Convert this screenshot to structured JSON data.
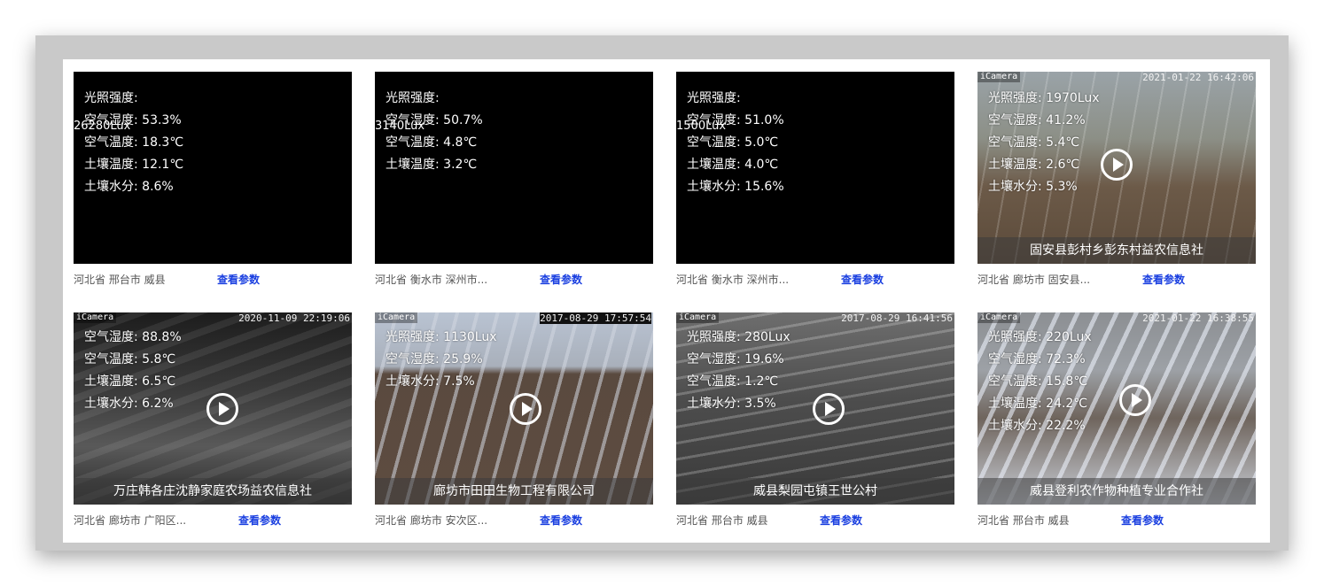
{
  "cards": [
    {
      "readings": [
        "光照强度:",
        "空气湿度: 53.3%",
        "空气温度: 18.3℃",
        "土壤温度: 12.1℃",
        "土壤水分: 8.6%"
      ],
      "lux_overlap": "26280Lux",
      "camera_tag": "",
      "timestamp": "",
      "caption": "",
      "location": "河北省 邢台市 威县",
      "params_label": "查看参数"
    },
    {
      "readings": [
        "光照强度:",
        "空气湿度: 50.7%",
        "空气温度: 4.8℃",
        "土壤温度: 3.2℃"
      ],
      "lux_overlap": "3140Lux",
      "camera_tag": "",
      "timestamp": "",
      "caption": "",
      "location": "河北省 衡水市 深州市...",
      "params_label": "查看参数"
    },
    {
      "readings": [
        "光照强度:",
        "空气湿度: 51.0%",
        "空气温度: 5.0℃",
        "土壤温度: 4.0℃",
        "土壤水分: 15.6%"
      ],
      "lux_overlap": "1500Lux",
      "camera_tag": "",
      "timestamp": "",
      "caption": "",
      "location": "河北省 衡水市 深州市...",
      "params_label": "查看参数"
    },
    {
      "readings": [
        "光照强度: 1970Lux",
        "空气湿度: 41.2%",
        "空气温度: 5.4℃",
        "土壤温度: 2.6℃",
        "土壤水分: 5.3%"
      ],
      "lux_overlap": "",
      "camera_tag": "iCamera",
      "timestamp": "2021-01-22 16:42:06",
      "caption": "固安县彭村乡彭东村益农信息社",
      "location": "河北省 廊坊市 固安县...",
      "params_label": "查看参数"
    },
    {
      "readings": [
        "空气湿度: 88.8%",
        "空气温度: 5.8℃",
        "土壤温度: 6.5℃",
        "土壤水分: 6.2%"
      ],
      "lux_overlap": "",
      "camera_tag": "iCamera",
      "timestamp": "2020-11-09 22:19:06",
      "caption": "万庄韩各庄沈静家庭农场益农信息社",
      "location": "河北省 廊坊市 广阳区...",
      "params_label": "查看参数"
    },
    {
      "readings": [
        "光照强度: 1130Lux",
        "空气湿度: 25.9%",
        "土壤水分: 7.5%"
      ],
      "lux_overlap": "",
      "camera_tag": "iCamera",
      "timestamp": "2017-08-29 17:57:54",
      "caption": "廊坊市田田生物工程有限公司",
      "location": "河北省 廊坊市 安次区...",
      "params_label": "查看参数"
    },
    {
      "readings": [
        "光照强度: 280Lux",
        "空气湿度: 19.6%",
        "空气温度: 1.2℃",
        "土壤水分: 3.5%"
      ],
      "lux_overlap": "",
      "camera_tag": "iCamera",
      "timestamp": "2017-08-29 16:41:56",
      "caption": "威县梨园屯镇王世公村",
      "location": "河北省 邢台市 威县",
      "params_label": "查看参数"
    },
    {
      "readings": [
        "光照强度: 220Lux",
        "空气湿度: 72.3%",
        "空气温度: 15.8℃",
        "土壤温度: 24.2℃",
        "土壤水分: 22.2%"
      ],
      "lux_overlap": "",
      "camera_tag": "iCamera",
      "timestamp": "2021-01-22 16:38:55",
      "caption": "威县登利农作物种植专业合作社",
      "location": "河北省 邢台市 威县",
      "params_label": "查看参数"
    }
  ],
  "icons": {
    "play": "play-circle-icon"
  },
  "colors": {
    "params_link": "#1a3fe0",
    "frame": "#c9c9c9"
  }
}
